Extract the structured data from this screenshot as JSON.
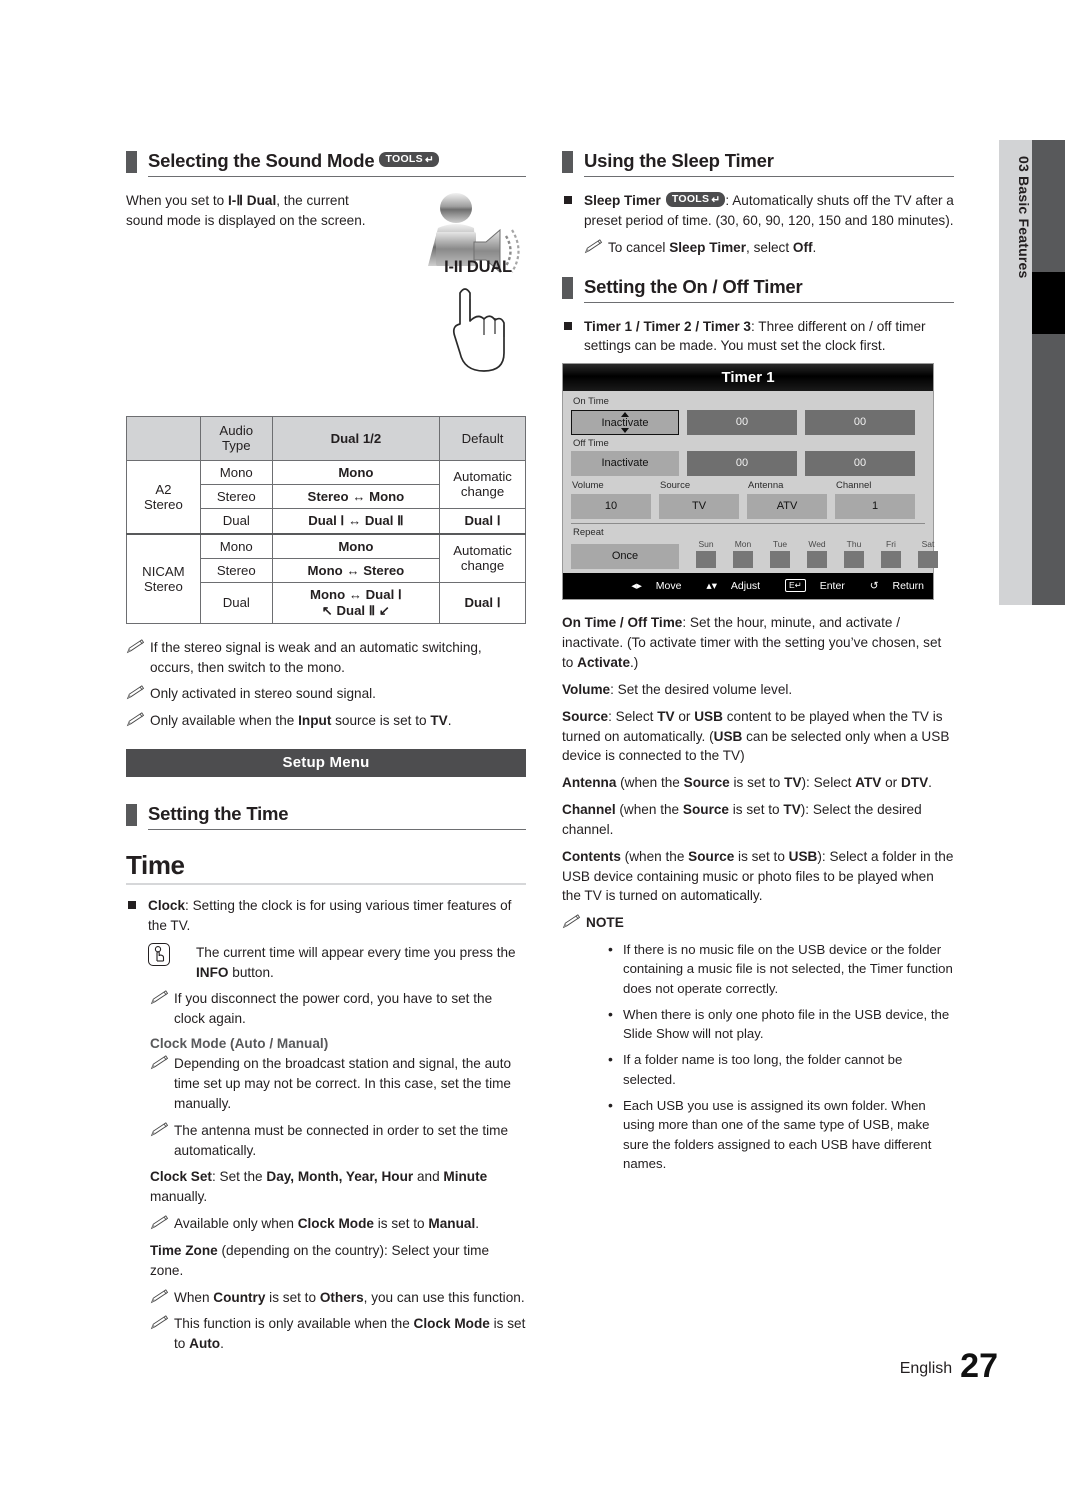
{
  "page": {
    "footer_language": "English",
    "footer_page_number": "27",
    "sidebar_chapter_number": "03",
    "sidebar_chapter_title": "Basic Features",
    "sidebar_label": "03  Basic Features"
  },
  "left_column": {
    "sound_mode": {
      "heading": "Selecting the Sound Mode",
      "heading_badge": "TOOLS",
      "intro": "When you set to I-Ⅱ Dual, the current sound mode is displayed on the screen.",
      "intro_bold": "I-Ⅱ Dual",
      "icon_label": "I-II DUAL",
      "table": {
        "headers": [
          "",
          "Audio Type",
          "Dual 1/2",
          "Default"
        ],
        "header_audio_line1": "Audio",
        "header_audio_line2": "Type",
        "rows": [
          {
            "group": "A2 Stereo",
            "group_line1": "A2",
            "group_line2": "Stereo",
            "cells": [
              {
                "type": "Mono",
                "dual": "Mono",
                "default": "Automatic change"
              },
              {
                "type": "Stereo",
                "dual": "Stereo ↔ Mono",
                "default": ""
              },
              {
                "type": "Dual",
                "dual": "Dual Ⅰ ↔ Dual Ⅱ",
                "default": "Dual Ⅰ"
              }
            ]
          },
          {
            "group": "NICAM Stereo",
            "group_line1": "NICAM",
            "group_line2": "Stereo",
            "cells": [
              {
                "type": "Mono",
                "dual": "Mono",
                "default": "Automatic change"
              },
              {
                "type": "Stereo",
                "dual": "Mono ↔ Stereo",
                "default": ""
              },
              {
                "type": "Dual",
                "dual": "Mono ↔ Dual Ⅰ",
                "dual_line2": "↖ Dual Ⅱ ↙",
                "default": "Dual Ⅰ"
              }
            ]
          }
        ]
      },
      "notes": [
        "If the stereo signal is weak and an automatic switching, occurs, then switch to the mono.",
        "Only activated in stereo sound signal.",
        "Only available when the Input source is set to TV."
      ]
    },
    "setup_menu_banner": "Setup Menu",
    "setting_time": {
      "heading": "Setting the Time",
      "big_title": "Time",
      "clock_item_label": "Clock",
      "clock_item_text": ": Setting the clock is for using various timer features of the TV.",
      "info_note": "The current time will appear every time you press the INFO button.",
      "info_note_bold": "INFO",
      "disconnect_note": "If you disconnect the power cord, you have to set the clock again.",
      "clock_mode_heading": "Clock Mode (Auto / Manual)",
      "clock_mode_note1": "Depending on the broadcast station and signal, the auto time set up may not be correct. In this case, set the time manually.",
      "clock_mode_note2": "The antenna must be connected in order to set the time automatically.",
      "clock_set_label": "Clock Set",
      "clock_set_text": ": Set the Day, Month, Year, Hour and Minute manually.",
      "clock_set_note": "Available only when Clock Mode is set to Manual.",
      "time_zone_label": "Time Zone",
      "time_zone_text": " (depending on the country): Select your time zone.",
      "time_zone_note1": "When Country is set to Others, you can use this function.",
      "time_zone_note2": "This function is only available when the Clock Mode is set to Auto."
    }
  },
  "right_column": {
    "sleep_timer": {
      "heading": "Using the Sleep Timer",
      "item_label": "Sleep Timer",
      "item_badge": "TOOLS",
      "item_text": ": Automatically shuts off the TV after a preset period of time. (30, 60, 90, 120, 150 and 180 minutes).",
      "note": "To cancel Sleep Timer, select Off.",
      "presets": [
        30,
        60,
        90,
        120,
        150,
        180
      ]
    },
    "on_off_timer": {
      "heading": "Setting the On / Off Timer",
      "item_label": "Timer 1 / Timer 2 / Timer 3",
      "item_text": ": Three different on / off timer settings can be made. You must set the clock first.",
      "osd": {
        "title": "Timer 1",
        "on_time_label": "On Time",
        "on_time_state": "Inactivate",
        "on_time_hour": "00",
        "on_time_minute": "00",
        "off_time_label": "Off Time",
        "off_time_state": "Inactivate",
        "off_time_hour": "00",
        "off_time_minute": "00",
        "volume_label": "Volume",
        "volume_value": "10",
        "source_label": "Source",
        "source_value": "TV",
        "antenna_label": "Antenna",
        "antenna_value": "ATV",
        "channel_label": "Channel",
        "channel_value": "1",
        "repeat_label": "Repeat",
        "repeat_value": "Once",
        "days": [
          "Sun",
          "Mon",
          "Tue",
          "Wed",
          "Thu",
          "Fri",
          "Sat"
        ],
        "footer_keys": [
          {
            "icon": "◀▶",
            "label": "Move"
          },
          {
            "icon": "⬍",
            "label": "Adjust"
          },
          {
            "icon": "E",
            "label": "Enter"
          },
          {
            "icon": "↺",
            "label": "Return"
          }
        ]
      },
      "descriptions": [
        {
          "label": "On Time / Off Time",
          "text": ": Set the hour, minute, and activate / inactivate. (To activate timer with the setting you've chosen, set to Activate.)"
        },
        {
          "label": "Volume",
          "text": ": Set the desired volume level."
        },
        {
          "label": "Source",
          "text": ": Select TV or USB content to be played when the TV is turned on automatically. (USB can be selected only when a USB device is connected to the TV)"
        },
        {
          "label": "Antenna",
          "text": " (when the Source is set to TV): Select ATV or DTV."
        },
        {
          "label": "Channel",
          "text": " (when the Source is set to TV): Select the desired channel."
        },
        {
          "label": "Contents",
          "text": " (when the Source is set to USB): Select a folder in the USB device containing music or photo files to be played when the TV is turned on automatically."
        }
      ],
      "note_heading": "NOTE",
      "note_items": [
        "If there is no music file on the USB device or the folder containing a music file is not selected, the Timer function does not operate correctly.",
        "When there is only one photo file in the USB device, the Slide Show will not play.",
        "If a folder name is too long, the folder cannot be selected.",
        "Each USB you use is assigned its own folder. When using more than one of the same type of USB, make sure the folders assigned to each USB have different names."
      ]
    }
  },
  "colors": {
    "text": "#231f20",
    "bar_dark": "#58595b",
    "banner": "#4d4d4f",
    "table_header_bg": "#d2d3d5",
    "osd_bg": "#cfcfcf",
    "osd_cell": "#a8a8a8",
    "osd_cell_dark": "#6f6f6f",
    "osd_title_bg": "#000000"
  }
}
